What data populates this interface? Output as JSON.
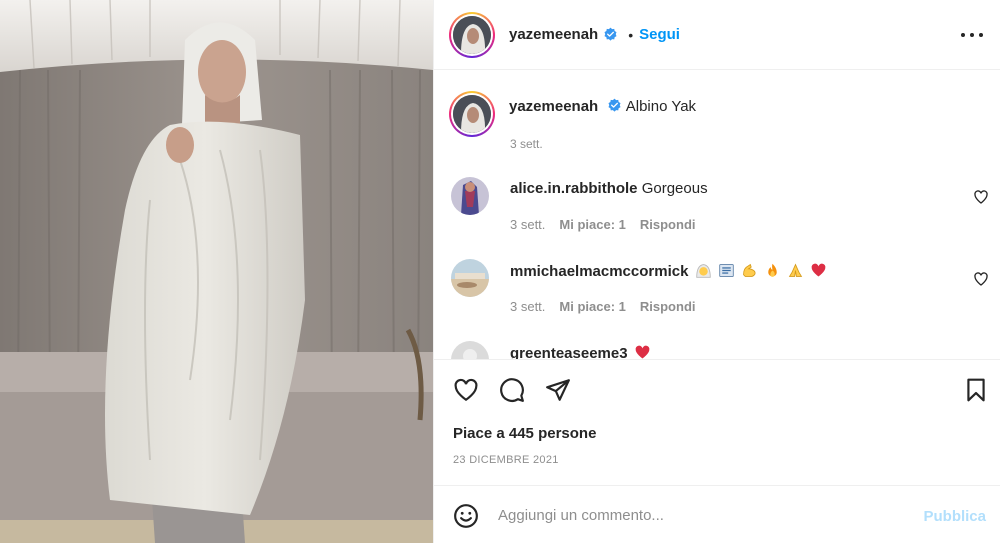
{
  "post": {
    "author": "yazemeenah",
    "verified": true,
    "separator": "•",
    "follow_label": "Segui",
    "caption_text": "Albino Yak",
    "caption_age": "3 sett."
  },
  "comments": [
    {
      "username": "alice.in.rabbithole",
      "text": "Gorgeous",
      "age": "3 sett.",
      "likes": "Mi piace: 1",
      "reply": "Rispondi"
    },
    {
      "username": "mmichaelmacmccormick",
      "text": "",
      "emojis": [
        "person-with-veil-emoji",
        "newspaper-emoji",
        "flexed-biceps-emoji",
        "fire-emoji",
        "folded-hands-emoji",
        "red-heart-emoji"
      ],
      "age": "3 sett.",
      "likes": "Mi piace: 1",
      "reply": "Rispondi"
    },
    {
      "username": "greenteaseeme3",
      "text": "",
      "emojis": [
        "red-heart-emoji"
      ]
    }
  ],
  "actions": {
    "likes_text": "Piace a 445 persone",
    "date_text": "23 DICEMBRE 2021"
  },
  "add_comment": {
    "placeholder": "Aggiungi un commento...",
    "publish_label": "Pubblica"
  },
  "colors": {
    "accent": "#0095f6",
    "publish_disabled": "#b2dffc",
    "secondary_text": "#8e8e8e",
    "heart_red": "#ed4956"
  }
}
